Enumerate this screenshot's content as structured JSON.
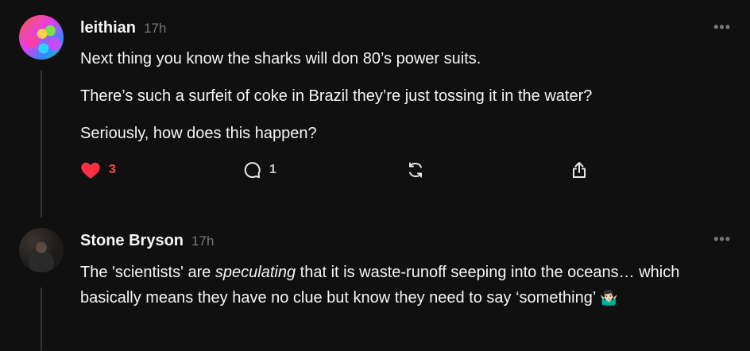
{
  "posts": [
    {
      "author": "leithian",
      "time": "17h",
      "paragraphs": [
        "Next thing you know the sharks will don 80’s power suits.",
        "There’s such a surfeit of coke in Brazil they’re just tossing it in the water?",
        "Seriously, how does this happen?"
      ],
      "likes": "3",
      "replies": "1",
      "liked": true
    },
    {
      "author": "Stone Bryson",
      "time": "17h",
      "text_part1": "The 'scientists' are ",
      "text_emphasis": "speculating",
      "text_part2": " that it is waste-runoff seeping into the oceans… which basically means they have no clue but know they need to say ‘something’ ",
      "emoji": "🤷🏻‍♂️"
    }
  ],
  "more_glyph": "•••",
  "icons": {
    "like": "heart-icon",
    "reply": "comment-icon",
    "repost": "repost-icon",
    "share": "share-icon",
    "more": "more-icon"
  },
  "colors": {
    "background": "#101010",
    "text": "#f3f5f7",
    "muted": "#777777",
    "like": "#ff4757"
  }
}
